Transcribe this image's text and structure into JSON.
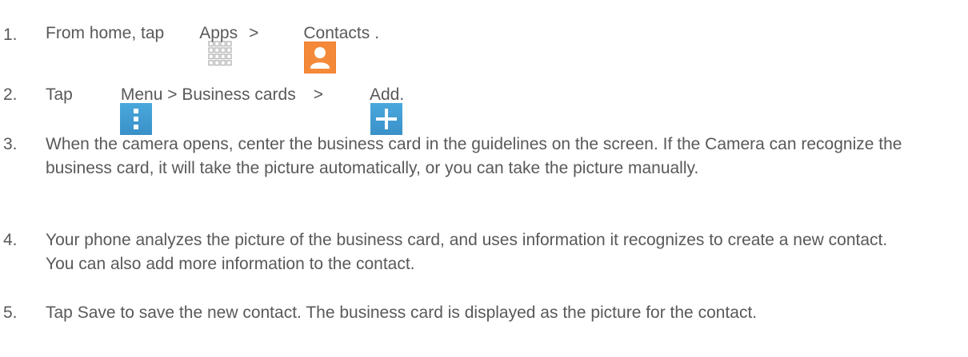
{
  "steps": [
    {
      "number": "1.",
      "parts": {
        "a": "From home, tap",
        "apps_label": "Apps",
        "sep": ">",
        "contacts_label": "Contacts",
        "end": "."
      }
    },
    {
      "number": "2.",
      "parts": {
        "a": "Tap",
        "menu_label": "Menu > Business cards",
        "sep": ">",
        "add_label": "Add."
      }
    },
    {
      "number": "3.",
      "text": "When the camera opens, center the business card in the guidelines on the screen. If the Camera can recognize the business card, it will take the picture automatically, or you can take the picture manually."
    },
    {
      "number": "4.",
      "text": "Your phone analyzes the picture of the business card, and uses information it recognizes to create a new contact. You can also add more information to the contact."
    },
    {
      "number": "5.",
      "text": "Tap Save to save the new contact. The business card is displayed as the picture for the contact."
    }
  ],
  "icons": {
    "apps": "apps-grid-icon",
    "contacts": "contacts-icon",
    "menu": "menu-icon",
    "add": "add-icon"
  },
  "colors": {
    "text": "#595959",
    "contacts_icon": "#f07f2e",
    "menu_icon": "#3f9bd3",
    "apps_icon": "#b9b9b9"
  }
}
